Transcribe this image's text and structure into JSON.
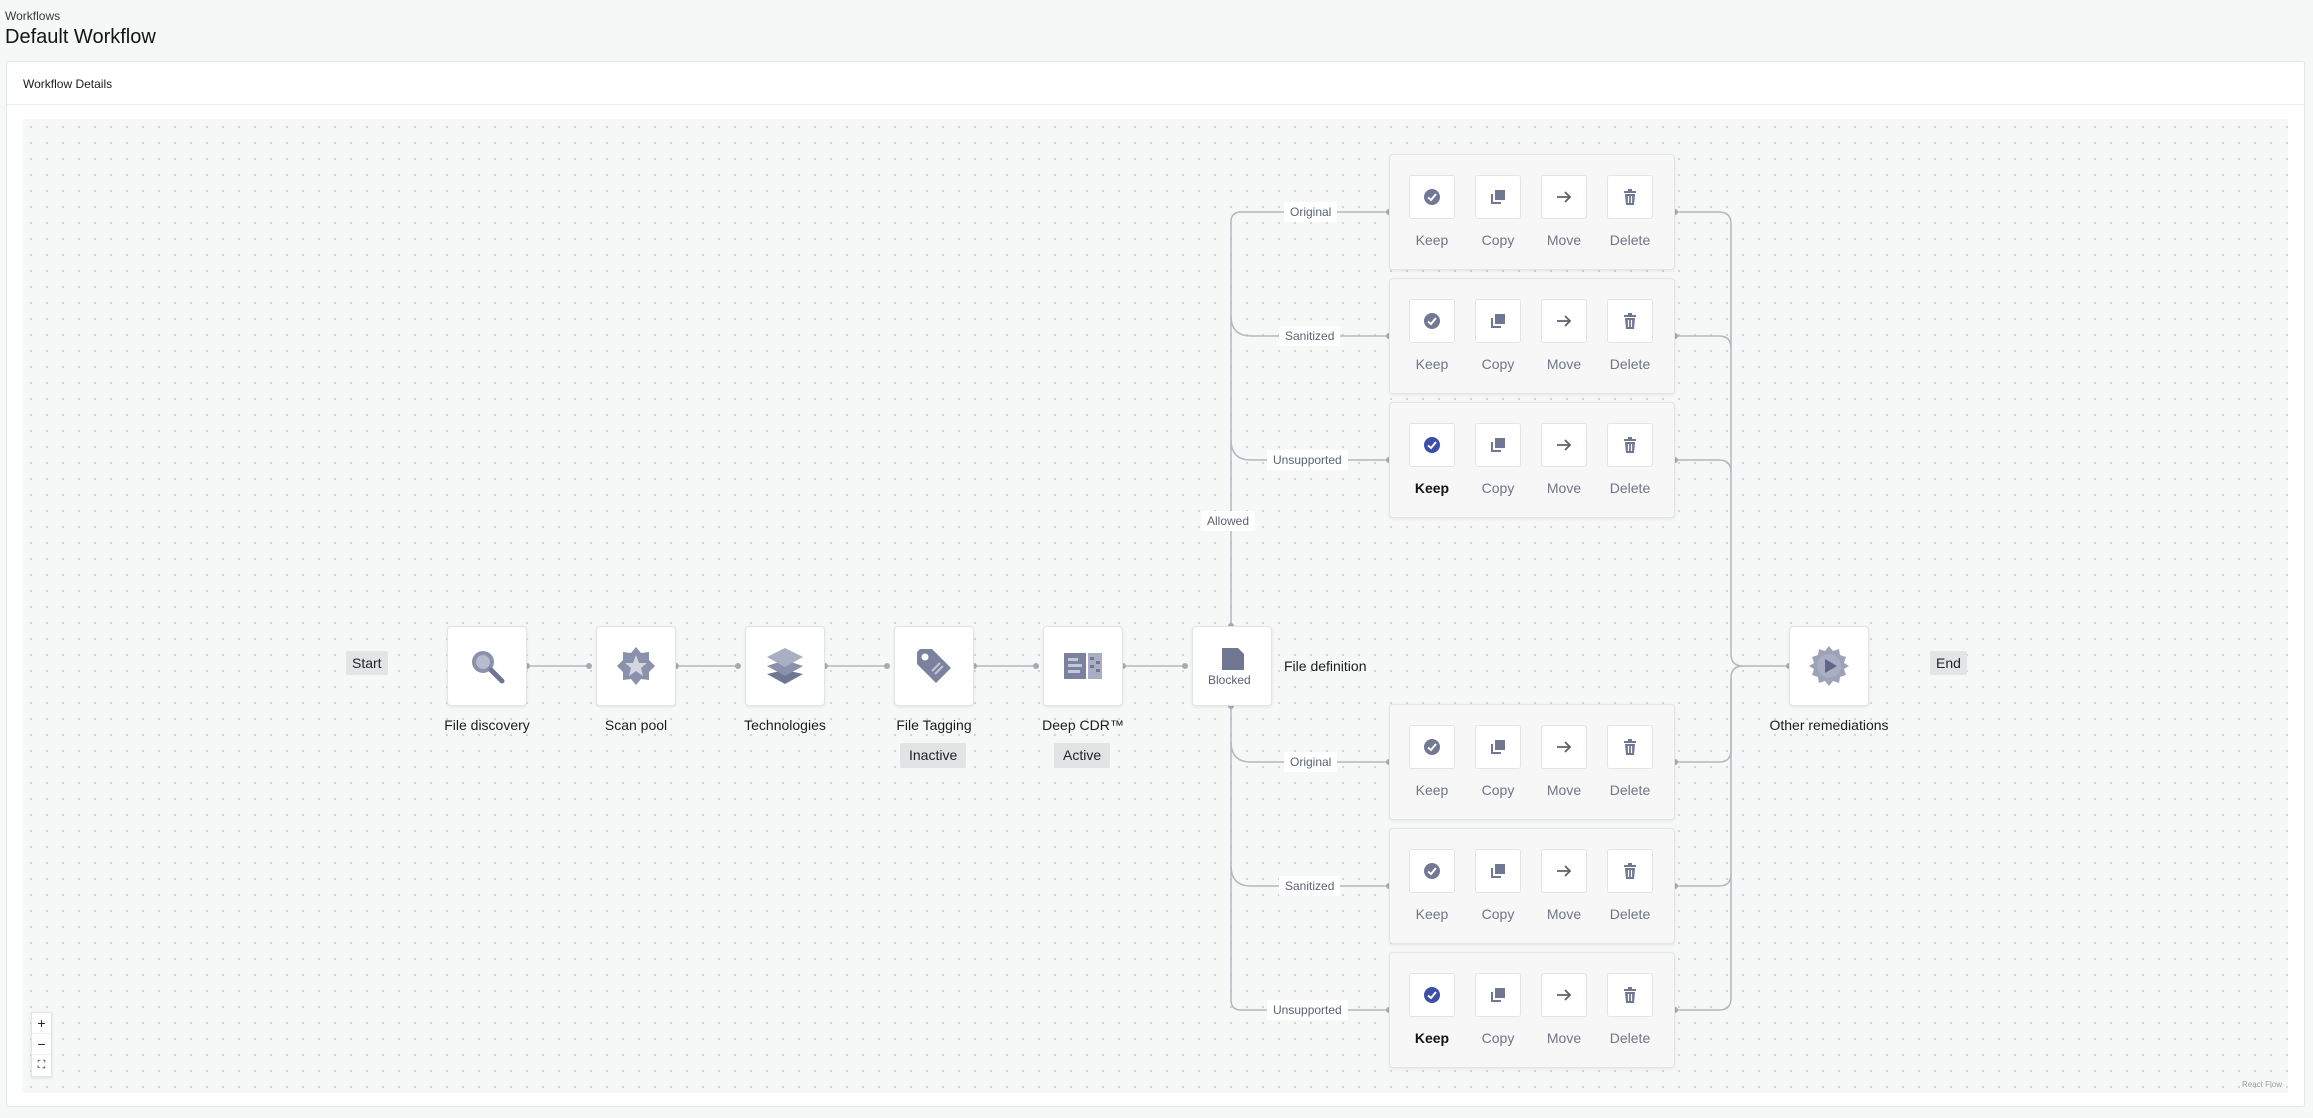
{
  "breadcrumb": "Workflows",
  "title": "Default Workflow",
  "panel": {
    "title": "Workflow Details"
  },
  "flow": {
    "start": "Start",
    "end": "End",
    "nodes": [
      {
        "label": "File discovery",
        "icon": "magnifier-icon"
      },
      {
        "label": "Scan pool",
        "icon": "star-badge-icon"
      },
      {
        "label": "Technologies",
        "icon": "layers-icon"
      },
      {
        "label": "File Tagging",
        "icon": "tag-icon",
        "status": "Inactive"
      },
      {
        "label": "Deep CDR™",
        "icon": "cdr-icon",
        "status": "Active"
      }
    ],
    "file_definition": {
      "label": "File definition",
      "icon": "document-icon"
    },
    "other_remediations": {
      "label": "Other remediations",
      "icon": "gear-play-icon"
    },
    "branches": {
      "allowed": "Allowed",
      "blocked": "Blocked"
    },
    "categories": [
      "Original",
      "Sanitized",
      "Unsupported",
      "Original",
      "Sanitized",
      "Unsupported"
    ],
    "actions": [
      "Keep",
      "Copy",
      "Move",
      "Delete"
    ],
    "selected_rows": [
      2,
      5
    ],
    "selected_action": "Keep"
  },
  "controls": {
    "zoom_in": "+",
    "zoom_out": "−",
    "fit": "⛶"
  },
  "attribution": "React Flow",
  "colors": {
    "icon": "#707894",
    "selected": "#3b4fa8",
    "edge": "#b4b7bd"
  }
}
